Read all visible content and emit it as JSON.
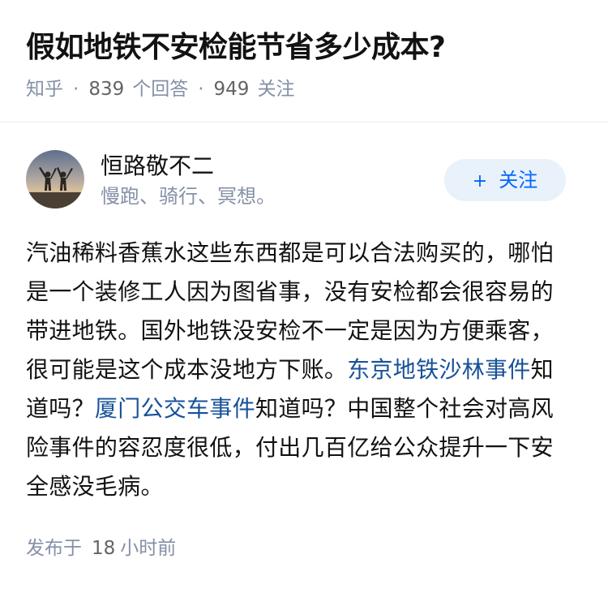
{
  "question": {
    "title": "假如地铁不安检能节省多少成本?",
    "source": "知乎",
    "separator": "·",
    "answers_count": "839",
    "answers_label": "个回答",
    "followers_count": "949",
    "followers_label": "关注"
  },
  "author": {
    "name": "恒路敬不二",
    "bio": "慢跑、骑行、冥想。",
    "follow_label": "关注",
    "follow_icon": "plus-icon"
  },
  "answer": {
    "text_1": "汽油稀料香蕉水这些东西都是可以合法购买的，哪怕是一个装修工人因为图省事，没有安检都会很容易的带进地铁。国外地铁没安检不一定是因为方便乘客，很可能是这个成本没地方下账。",
    "link_1": "东京地铁沙林事件",
    "text_2": "知道吗？",
    "link_2": "厦门公交车事件",
    "text_3": "知道吗？中国整个社会对高风险事件的容忍度很低，付出几百亿给公众提升一下安全感没毛病。"
  },
  "footer": {
    "published_label": "发布于",
    "time_value": "18",
    "time_unit": "小时前"
  },
  "colors": {
    "title": "#121212",
    "meta": "#8590a6",
    "link": "#175199",
    "follow_bg": "#e9f1fb",
    "follow_text": "#0066ff"
  }
}
